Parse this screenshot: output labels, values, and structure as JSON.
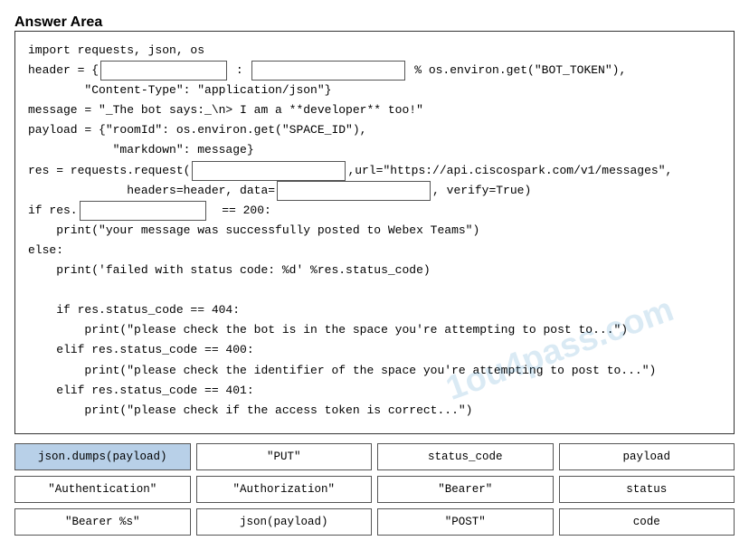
{
  "page": {
    "title": "Answer Area"
  },
  "code": {
    "line1": "import requests, json, os",
    "line2a": "header = {",
    "line2b": "          : ",
    "line2c": " % os.environ.get(\"BOT_TOKEN\"),",
    "line3": "        \"Content-Type\": \"application/json\"}",
    "line4": "message = \"_The bot says:_\\n> I am a **developer** too!\"",
    "line5a": "payload = {\"roomId\": os.environ.get(\"SPACE_ID\"),",
    "line5b": "            \"markdown\": message}",
    "line6a": "res = requests.request(",
    "line6b": "          ,url=\"https://api.ciscospark.com/v1/messages\",",
    "line7a": "              headers=header, data=",
    "line7b": ", verify=True)",
    "line8a": "if res.",
    "line8b": "    == 200:",
    "line9": "    print(\"your message was successfully posted to Webex Teams\")",
    "line10": "else:",
    "line11": "    print('failed with status code: %d' %res.status_code)",
    "line12": "",
    "line13": "    if res.status_code == 404:",
    "line14": "        print(\"please check the bot is in the space you're attempting to post to...\")",
    "line15": "    elif res.status_code == 400:",
    "line16": "        print(\"please check the identifier of the space you're attempting to post to...\")",
    "line17": "    elif res.status_code == 401:",
    "line18": "        print(\"please check if the access token is correct...\")"
  },
  "options": {
    "row1": [
      {
        "label": "json.dumps(payload)",
        "selected": true
      },
      {
        "label": "\"PUT\"",
        "selected": false
      },
      {
        "label": "status_code",
        "selected": false
      },
      {
        "label": "payload",
        "selected": false
      }
    ],
    "row2": [
      {
        "label": "\"Authentication\"",
        "selected": false
      },
      {
        "label": "\"Authorization\"",
        "selected": false
      },
      {
        "label": "\"Bearer\"",
        "selected": false
      },
      {
        "label": "status",
        "selected": false
      }
    ],
    "row3": [
      {
        "label": "\"Bearer %s\"",
        "selected": false
      },
      {
        "label": "json(payload)",
        "selected": false
      },
      {
        "label": "\"POST\"",
        "selected": false
      },
      {
        "label": "code",
        "selected": false
      }
    ]
  },
  "watermark": "1ou4pass.com"
}
